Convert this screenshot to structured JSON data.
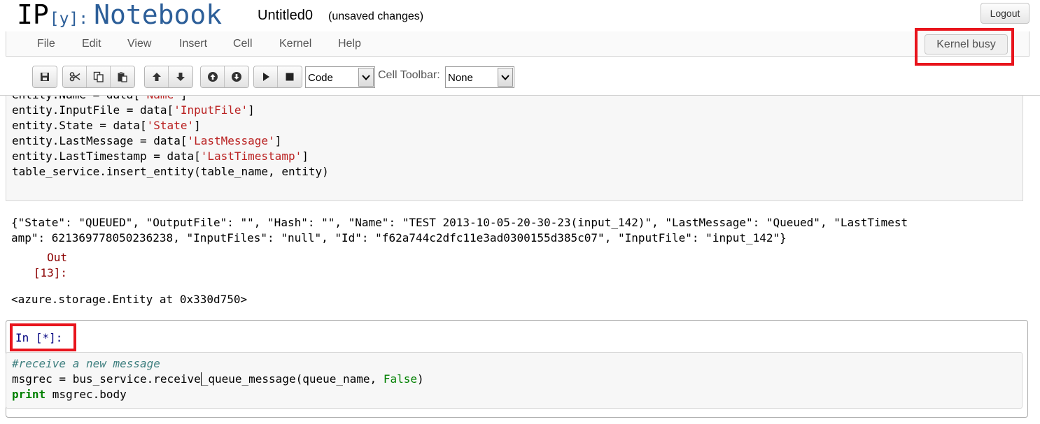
{
  "header": {
    "logo_ip": "IP",
    "logo_y": "[y]:",
    "logo_notebook": "Notebook",
    "notebook_name": "Untitled0",
    "save_status": "(unsaved changes)",
    "logout_label": "Logout"
  },
  "menubar": {
    "items": [
      "File",
      "Edit",
      "View",
      "Insert",
      "Cell",
      "Kernel",
      "Help"
    ],
    "kernel_status": "Kernel busy"
  },
  "toolbar": {
    "buttons": [
      "save-icon",
      "cut-icon",
      "copy-icon",
      "paste-icon",
      "move-up-icon",
      "move-down-icon",
      "insert-above-icon",
      "insert-below-icon",
      "run-icon",
      "stop-icon"
    ],
    "cell_type": "Code",
    "cell_toolbar_label": "Cell Toolbar:",
    "cell_toolbar_value": "None"
  },
  "cell1": {
    "lines": [
      {
        "a": "entity.Name = data[",
        "s": "'Name'",
        "b": "]"
      },
      {
        "a": "entity.InputFile = data[",
        "s": "'InputFile'",
        "b": "]"
      },
      {
        "a": "entity.State = data[",
        "s": "'State'",
        "b": "]"
      },
      {
        "a": "entity.LastMessage = data[",
        "s": "'LastMessage'",
        "b": "]"
      },
      {
        "a": "entity.LastTimestamp = data[",
        "s": "'LastTimestamp'",
        "b": "]"
      },
      {
        "a": "table_service.insert_entity(table_name, entity)",
        "s": "",
        "b": ""
      }
    ],
    "stdout": [
      "{\"State\": \"QUEUED\", \"OutputFile\": \"\", \"Hash\": \"\", \"Name\": \"TEST 2013-10-05-20-30-23(input_142)\", \"LastMessage\": \"Queued\", \"LastTimest",
      "amp\": 621369778050236238, \"InputFiles\": \"null\", \"Id\": \"f62a744c2dfc11e3ad0300155d385c07\", \"InputFile\": \"input_142\"}"
    ],
    "out_prompt": "Out\n[13]:",
    "result": "<azure.storage.Entity at 0x330d750>"
  },
  "cell2": {
    "in_prompt": "In [*]:",
    "comment": "#receive a new message",
    "line2_before_cursor": "msgrec = bus_service.receive",
    "line2_after_cursor": "_queue_message(queue_name, ",
    "line2_false": "False",
    "line2_end": ")",
    "line3_keyword": "print",
    "line3_rest": " msgrec.body"
  },
  "colors": {
    "brand_blue": "#2d5f99",
    "highlight_red": "#e8141c",
    "string_red": "#ba2121",
    "comment_teal": "#408080",
    "keyword_green": "#008000",
    "out_prompt": "#8b0000",
    "in_prompt": "#000080"
  }
}
